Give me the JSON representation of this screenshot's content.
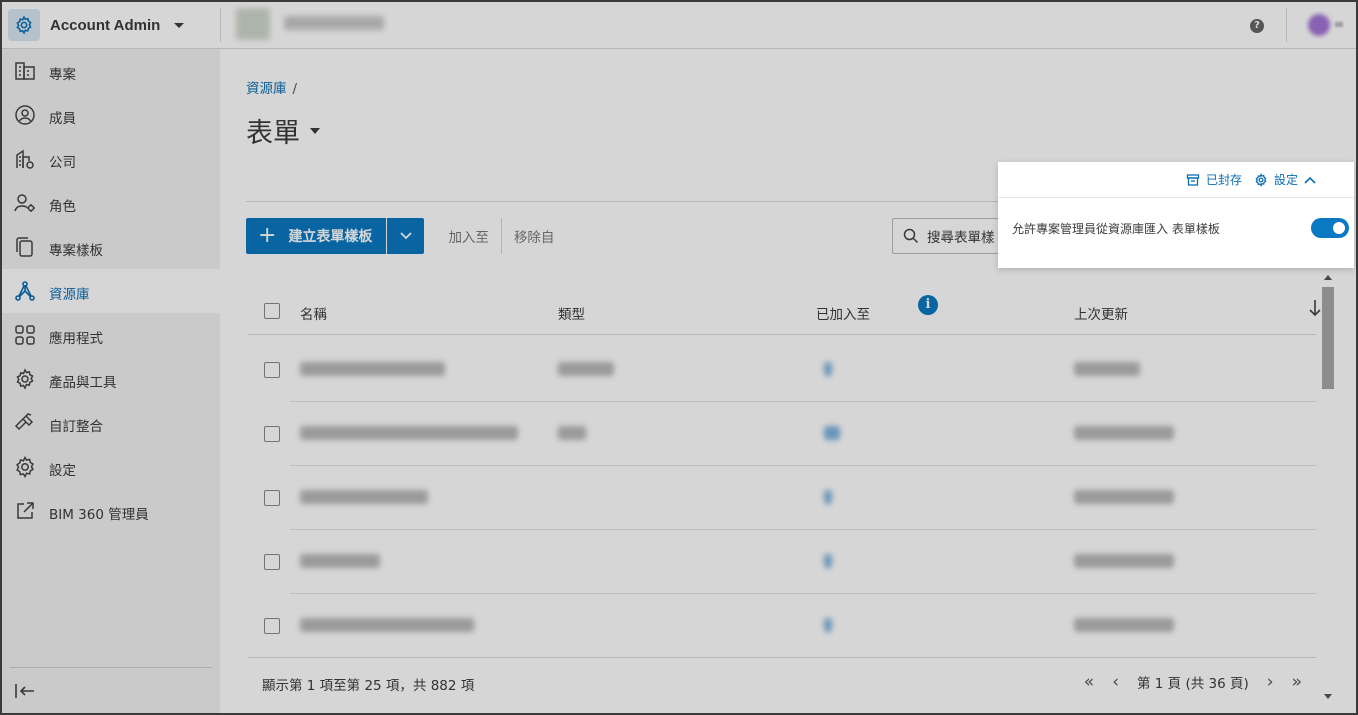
{
  "app": {
    "title": "Account Admin"
  },
  "sidebar": {
    "items": [
      {
        "label": "專案",
        "icon": "building-icon"
      },
      {
        "label": "成員",
        "icon": "user-circle-icon"
      },
      {
        "label": "公司",
        "icon": "company-icon"
      },
      {
        "label": "角色",
        "icon": "user-gear-icon"
      },
      {
        "label": "專案樣板",
        "icon": "copy-icon"
      },
      {
        "label": "資源庫",
        "icon": "library-icon",
        "active": true
      },
      {
        "label": "應用程式",
        "icon": "apps-grid-icon"
      },
      {
        "label": "產品與工具",
        "icon": "product-gear-icon"
      },
      {
        "label": "自訂整合",
        "icon": "hammer-icon"
      },
      {
        "label": "設定",
        "icon": "gear-icon"
      },
      {
        "label": "BIM 360 管理員",
        "icon": "external-link-icon"
      }
    ]
  },
  "breadcrumb": {
    "root": "資源庫",
    "sep": "/"
  },
  "page": {
    "title": "表單"
  },
  "toolbar": {
    "create_label": "建立表單樣板",
    "add_to_label": "加入至",
    "remove_from_label": "移除自"
  },
  "search": {
    "placeholder": "搜尋表單樣"
  },
  "table": {
    "headers": {
      "name": "名稱",
      "type": "類型",
      "added_to": "已加入至",
      "updated": "上次更新"
    },
    "row_count_visible": 5
  },
  "footer": {
    "summary": "顯示第 1 項至第 25 項，共 882 項",
    "page_label": "第 1 頁 (共 36 頁)"
  },
  "popover": {
    "archived_label": "已封存",
    "settings_label": "設定",
    "toggle_label": "允許專案管理員從資源庫匯入 表單樣板",
    "toggle_on": true
  },
  "colors": {
    "accent": "#0b79c2",
    "link": "#0b6eb4",
    "sidebar_bg": "#f1f1f1"
  }
}
